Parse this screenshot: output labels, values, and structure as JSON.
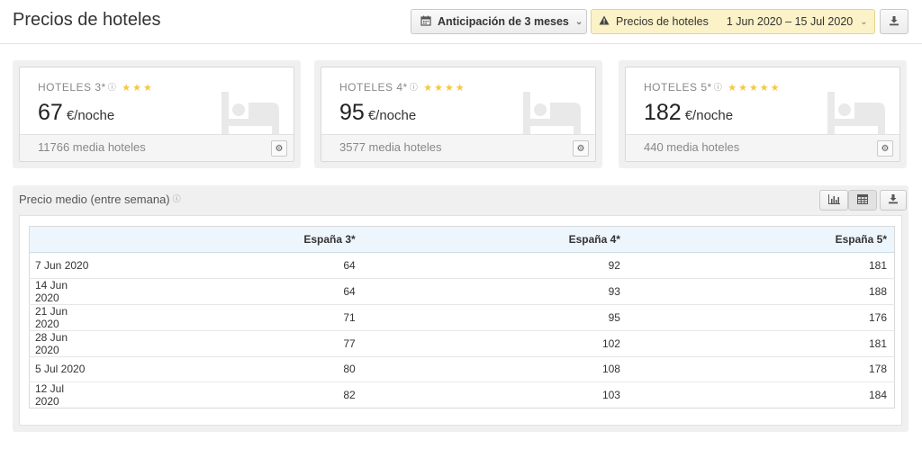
{
  "header": {
    "title": "Precios de hoteles",
    "anticipation_label": "Anticipación de 3 meses",
    "filter_label": "Precios de hoteles",
    "date_range": "1 Jun 2020 – 15 Jul 2020"
  },
  "cards": [
    {
      "label": "HOTELES 3*",
      "stars": "★★★",
      "value": "67",
      "unit": "€/noche",
      "footer": "11766 media hoteles"
    },
    {
      "label": "HOTELES 4*",
      "stars": "★★★★",
      "value": "95",
      "unit": "€/noche",
      "footer": "3577 media hoteles"
    },
    {
      "label": "HOTELES 5*",
      "stars": "★★★★★",
      "value": "182",
      "unit": "€/noche",
      "footer": "440 media hoteles"
    }
  ],
  "panel": {
    "title": "Precio medio (entre semana)"
  },
  "table": {
    "columns": [
      "",
      "España 3*",
      "España 4*",
      "España 5*"
    ],
    "rows": [
      [
        "7 Jun 2020",
        "64",
        "92",
        "181"
      ],
      [
        "14 Jun 2020",
        "64",
        "93",
        "188"
      ],
      [
        "21 Jun 2020",
        "71",
        "95",
        "176"
      ],
      [
        "28 Jun 2020",
        "77",
        "102",
        "181"
      ],
      [
        "5 Jul 2020",
        "80",
        "108",
        "178"
      ],
      [
        "12 Jul 2020",
        "82",
        "103",
        "184"
      ]
    ]
  },
  "colors": {
    "accent_warning_bg": "#fcf2c8",
    "star": "#f5c842",
    "table_header_bg": "#eef6fd"
  },
  "icons": [
    "calendar-icon",
    "chevron-down-icon",
    "warning-icon",
    "download-icon",
    "question-icon",
    "star-icon",
    "bed-icon",
    "gear-icon",
    "bar-chart-icon",
    "table-icon"
  ]
}
